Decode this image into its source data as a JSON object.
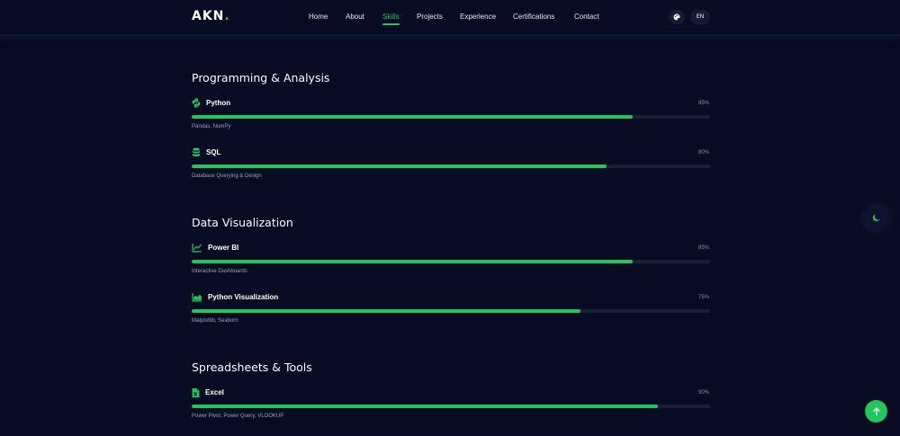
{
  "brand": {
    "logo_text": "AKN",
    "logo_dot": "."
  },
  "nav": {
    "links": [
      {
        "label": "Home"
      },
      {
        "label": "About"
      },
      {
        "label": "Skills",
        "active": true
      },
      {
        "label": "Projects"
      },
      {
        "label": "Experience"
      },
      {
        "label": "Certifications"
      },
      {
        "label": "Contact"
      }
    ],
    "palette_icon": "palette-icon",
    "lang_label": "EN"
  },
  "colors": {
    "accent": "#22c55e",
    "background": "#080c22",
    "track": "#1a1f36",
    "text_muted": "#9aa0b8"
  },
  "sections": [
    {
      "title": "Programming & Analysis",
      "skills": [
        {
          "name": "Python",
          "percent_label": "85%",
          "level": 85,
          "desc": "Pandas, NumPy",
          "icon": "python-icon"
        },
        {
          "name": "SQL",
          "percent_label": "80%",
          "level": 80,
          "desc": "Database Querying & Design",
          "icon": "database-icon"
        }
      ]
    },
    {
      "title": "Data Visualization",
      "skills": [
        {
          "name": "Power BI",
          "percent_label": "85%",
          "level": 85,
          "desc": "Interactive Dashboards",
          "icon": "line-chart-icon"
        },
        {
          "name": "Python Visualization",
          "percent_label": "75%",
          "level": 75,
          "desc": "Matplotlib, Seaborn",
          "icon": "area-chart-icon"
        }
      ]
    },
    {
      "title": "Spreadsheets & Tools",
      "skills": [
        {
          "name": "Excel",
          "percent_label": "90%",
          "level": 90,
          "desc": "Power Pivot, Power Query, VLOOKUP",
          "icon": "excel-icon"
        }
      ]
    }
  ],
  "floating": {
    "theme_toggle_icon": "moon-icon",
    "scroll_top_icon": "arrow-up-icon"
  }
}
